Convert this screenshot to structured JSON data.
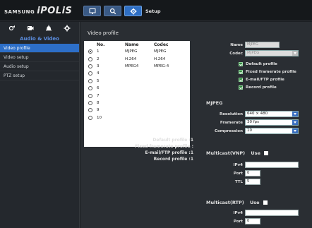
{
  "header": {
    "brand": "SAMSUNG",
    "product": "iPOLiS",
    "buttons": [
      {
        "name": "live-view",
        "icon": "monitor-icon"
      },
      {
        "name": "search",
        "icon": "search-icon"
      },
      {
        "name": "setup",
        "icon": "gear-icon"
      }
    ],
    "title": "Setup"
  },
  "sidebar": {
    "icons": [
      "camera-icon",
      "video-icon",
      "alarm-icon",
      "settings-icon"
    ],
    "category": "Audio & Video",
    "items": [
      {
        "label": "Video profile",
        "selected": true
      },
      {
        "label": "Video setup",
        "selected": false
      },
      {
        "label": "Audio setup",
        "selected": false
      },
      {
        "label": "PTZ setup",
        "selected": false
      }
    ]
  },
  "main": {
    "section_title": "Video profile",
    "table": {
      "headers": [
        "No.",
        "Name",
        "Codec"
      ],
      "rows": [
        {
          "no": "1",
          "name": "MJPEG",
          "codec": "MJPEG",
          "selected": true
        },
        {
          "no": "2",
          "name": "H.264",
          "codec": "H.264",
          "selected": false
        },
        {
          "no": "3",
          "name": "MPEG4",
          "codec": "MPEG-4",
          "selected": false
        },
        {
          "no": "4",
          "name": "",
          "codec": "",
          "selected": false
        },
        {
          "no": "5",
          "name": "",
          "codec": "",
          "selected": false
        },
        {
          "no": "6",
          "name": "",
          "codec": "",
          "selected": false
        },
        {
          "no": "7",
          "name": "",
          "codec": "",
          "selected": false
        },
        {
          "no": "8",
          "name": "",
          "codec": "",
          "selected": false
        },
        {
          "no": "9",
          "name": "",
          "codec": "",
          "selected": false
        },
        {
          "no": "10",
          "name": "",
          "codec": "",
          "selected": false
        }
      ]
    },
    "summary": {
      "default": "Default profile :1",
      "fixed": "Fixed framerate profile :",
      "email": "E-mail/FTP profile :1",
      "record": "Record profile :1"
    }
  },
  "settings": {
    "name_label": "Name",
    "name_value": "MJPEG",
    "codec_label": "Codec",
    "codec_value": "MJPEG",
    "checkboxes": [
      {
        "label": "Default profile",
        "checked": true
      },
      {
        "label": "Fixed framerate profile",
        "checked": true
      },
      {
        "label": "E-mail/FTP profile",
        "checked": true
      },
      {
        "label": "Record profile",
        "checked": true
      }
    ],
    "mjpeg_title": "MJPEG",
    "resolution_label": "Resolution",
    "resolution_value": "640 × 480",
    "framerate_label": "Framerate",
    "framerate_value": "30 fps",
    "compression_label": "Compression",
    "compression_value": "10",
    "multicast_vnp_title": "Multicast(VNP)",
    "use_label": "Use",
    "ipv4_label": "IPv4",
    "port_label": "Port",
    "port_value": "0",
    "ttl_label": "TTL",
    "ttl_value": "5",
    "multicast_rtp_title": "Multicast(RTP)",
    "rtp_ipv4_label": "IPv4",
    "rtp_port_label": "Port",
    "rtp_port_value": "0"
  },
  "colors": {
    "accent": "#2d6fc8",
    "category": "#5c8ee0",
    "checkbox": "#2e8b3c"
  }
}
